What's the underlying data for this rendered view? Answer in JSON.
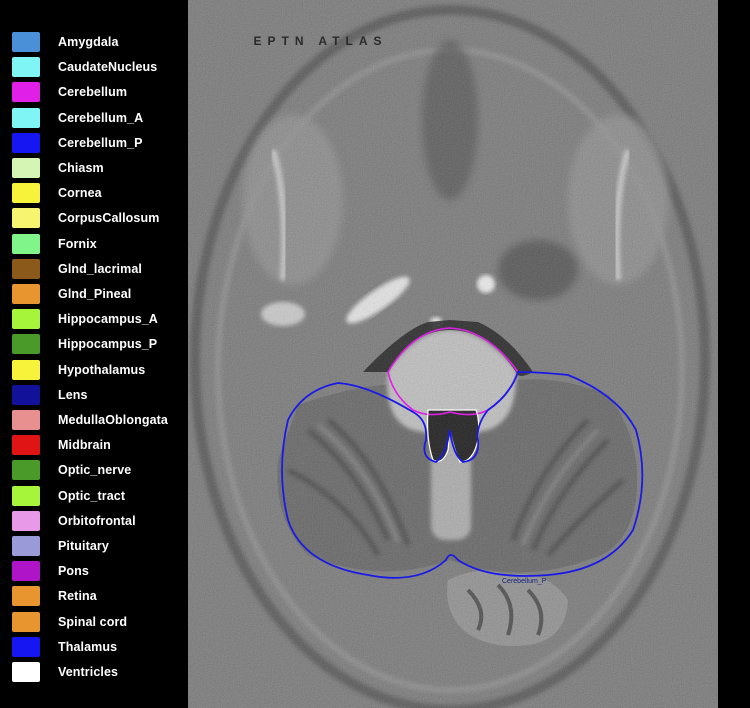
{
  "atlas_title": "EPTN ATLAS",
  "legend": {
    "items": [
      {
        "label": "Amygdala",
        "color": "#4a90d9"
      },
      {
        "label": "CaudateNucleus",
        "color": "#7ff5f5"
      },
      {
        "label": "Cerebellum",
        "color": "#e01fe8"
      },
      {
        "label": "Cerebellum_A",
        "color": "#7ff5f5"
      },
      {
        "label": "Cerebellum_P",
        "color": "#1616f2"
      },
      {
        "label": "Chiasm",
        "color": "#d5f5b5"
      },
      {
        "label": "Cornea",
        "color": "#f7f33a"
      },
      {
        "label": "CorpusCallosum",
        "color": "#f7f56f"
      },
      {
        "label": "Fornix",
        "color": "#7ff58a"
      },
      {
        "label": "Glnd_lacrimal",
        "color": "#8b5a1a"
      },
      {
        "label": "Glnd_Pineal",
        "color": "#e89530"
      },
      {
        "label": "Hippocampus_A",
        "color": "#a7f53a"
      },
      {
        "label": "Hippocampus_P",
        "color": "#4a9a2a"
      },
      {
        "label": "Hypothalamus",
        "color": "#f7f33a"
      },
      {
        "label": "Lens",
        "color": "#11119a"
      },
      {
        "label": "MedullaOblongata",
        "color": "#e89090"
      },
      {
        "label": "Midbrain",
        "color": "#e01414"
      },
      {
        "label": "Optic_nerve",
        "color": "#4a9a2a"
      },
      {
        "label": "Optic_tract",
        "color": "#a7f53a"
      },
      {
        "label": "Orbitofrontal",
        "color": "#e89ae8"
      },
      {
        "label": "Pituitary",
        "color": "#9a9ad9"
      },
      {
        "label": "Pons",
        "color": "#b014c8"
      },
      {
        "label": "Retina",
        "color": "#e89530"
      },
      {
        "label": "Spinal cord",
        "color": "#e89530"
      },
      {
        "label": "Thalamus",
        "color": "#1616f2"
      },
      {
        "label": "Ventricles",
        "color": "#ffffff"
      }
    ]
  },
  "contour_label": "Cerebellum_P"
}
